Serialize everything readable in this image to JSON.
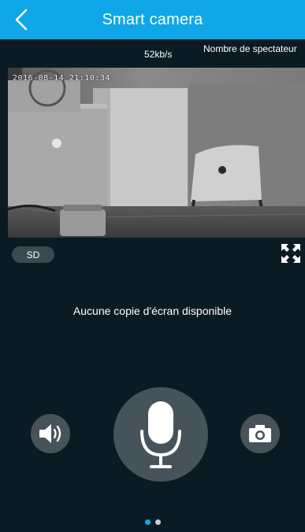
{
  "header": {
    "title": "Smart camera",
    "back_icon": "chevron-left-icon",
    "background": "#0fa7e7"
  },
  "stream": {
    "bitrate": "52kb/s",
    "viewers_label": "Nombre de spectateur",
    "timestamp": "2016-08-14 21:10:34",
    "quality": "SD"
  },
  "gallery": {
    "empty_text": "Aucune copie d'écran disponible"
  },
  "controls": {
    "volume_icon": "speaker-icon",
    "mic_icon": "microphone-icon",
    "camera_icon": "camera-icon",
    "fullscreen_icon": "fullscreen-icon"
  },
  "pager": {
    "total": 2,
    "active": 0,
    "active_color": "#0fa7e7"
  }
}
